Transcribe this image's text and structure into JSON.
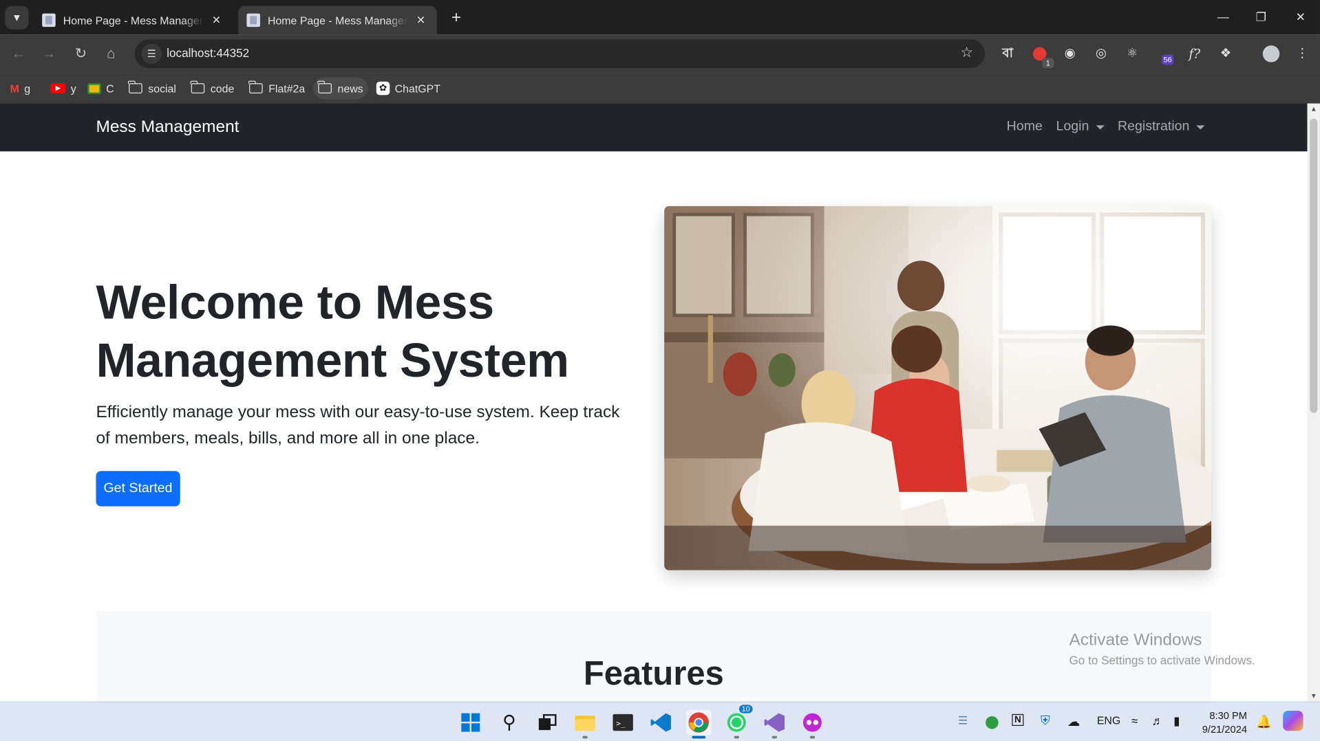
{
  "browser": {
    "tabs": [
      {
        "title": "Home Page - Mess Management",
        "active": false
      },
      {
        "title": "Home Page - Mess Management",
        "active": true
      }
    ],
    "url": "localhost:44352",
    "extension_badges": {
      "adblock": "1",
      "purple": "56"
    },
    "extension_glyph": "বা",
    "bookmarks": [
      {
        "label": "g",
        "icon": "gmail-icon"
      },
      {
        "label": "y",
        "icon": "youtube-icon"
      },
      {
        "label": "C",
        "icon": "classroom-icon"
      },
      {
        "label": "social",
        "icon": "folder-icon"
      },
      {
        "label": "code",
        "icon": "folder-icon"
      },
      {
        "label": "Flat#2a",
        "icon": "folder-icon"
      },
      {
        "label": "news",
        "icon": "folder-icon"
      },
      {
        "label": "ChatGPT",
        "icon": "chatgpt-icon"
      }
    ]
  },
  "site": {
    "brand": "Mess Management",
    "nav": {
      "home": "Home",
      "login": "Login",
      "registration": "Registration"
    },
    "hero": {
      "title": "Welcome to Mess Management System",
      "lead": "Efficiently manage your mess with our easy-to-use system. Keep track of members, meals, bills, and more all in one place.",
      "cta": "Get Started"
    },
    "features_title": "Features"
  },
  "watermark": {
    "line1": "Activate Windows",
    "line2": "Go to Settings to activate Windows."
  },
  "taskbar": {
    "whatsapp_badge": "10",
    "language": "ENG",
    "time": "8:30 PM",
    "date": "9/21/2024"
  },
  "colors": {
    "primary": "#0d6efd",
    "navbar": "#212529",
    "features_bg": "#f8f9fa"
  }
}
